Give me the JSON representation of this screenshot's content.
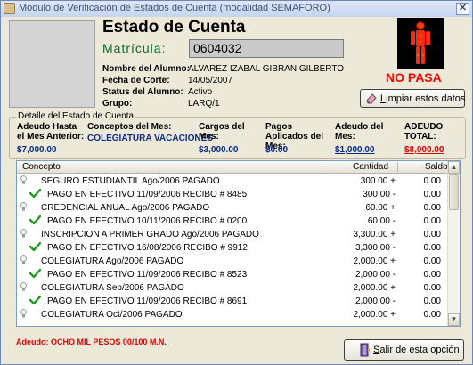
{
  "window": {
    "title": "Módulo de Verificación de Estados de Cuenta (modalidad SEMAFORO)",
    "close_label": "✕"
  },
  "header": {
    "title": "Estado de Cuenta",
    "matricula_label": "Matrícula:",
    "matricula_value": "0604032",
    "status_text": "NO PASA",
    "semaforo_icon": "red-pedestrian-light-icon",
    "status_color": "#ff0000"
  },
  "student": [
    {
      "label": "Nombre del Alumno:",
      "value": "ALVAREZ IZABAL  GIBRAN GILBERTO"
    },
    {
      "label": "Fecha de Corte:",
      "value": "14/05/2007"
    },
    {
      "label": "Status del Alumno:",
      "value": "Activo"
    },
    {
      "label": "Grupo:",
      "value": "LARQ/1"
    }
  ],
  "buttons": {
    "clear_label_u": "L",
    "clear_label_rest": "impiar estos datos",
    "exit_label_u": "S",
    "exit_label_rest": "alir de esta opción"
  },
  "detail": {
    "group_title": "Detalle del Estado de Cuenta",
    "col1_label": "Adeudo Hasta el Mes Anterior:",
    "col1_value": "$7,000.00",
    "col2_label": "Conceptos del Mes:",
    "col2_value": "COLEGIATURA VACACIONES",
    "col3_label": "Cargos del Mes:",
    "col3_value": "$3,000.00",
    "col4_label": "Pagos Aplicados del Mes:",
    "col4_value": "$0.00",
    "col5_label": "Adeudo del Mes:",
    "col5_value": "$1,000.00",
    "col6_label": "ADEUDO TOTAL:",
    "col6_value": "$8,000.00",
    "total_color": "#e00000",
    "value_color": "#0b2c8c"
  },
  "grid": {
    "headers": {
      "concepto": "Concepto",
      "cantidad": "Cantidad",
      "saldo": "Saldo"
    },
    "rows": [
      {
        "icon": "lightbulb-icon",
        "text": "SEGURO ESTUDIANTIL Ago/2006  PAGADO",
        "qty": "300.00 +",
        "bal": "0.00"
      },
      {
        "icon": "checkmark-icon",
        "text": "PAGO EN EFECTIVO 11/09/2006  RECIBO # 8485",
        "qty": "300.00 -",
        "bal": "0.00"
      },
      {
        "icon": "lightbulb-icon",
        "text": "CREDENCIAL ANUAL Ago/2006  PAGADO",
        "qty": "60.00 +",
        "bal": "0.00"
      },
      {
        "icon": "checkmark-icon",
        "text": "PAGO EN EFECTIVO 10/11/2006  RECIBO # 0200",
        "qty": "60.00 -",
        "bal": "0.00"
      },
      {
        "icon": "lightbulb-icon",
        "text": "INSCRIPCION A PRIMER GRADO Ago/2006  PAGADO",
        "qty": "3,300.00 +",
        "bal": "0.00"
      },
      {
        "icon": "checkmark-icon",
        "text": "PAGO EN EFECTIVO 16/08/2006  RECIBO # 9912",
        "qty": "3,300.00 -",
        "bal": "0.00"
      },
      {
        "icon": "lightbulb-icon",
        "text": "COLEGIATURA Ago/2006  PAGADO",
        "qty": "2,000.00 +",
        "bal": "0.00"
      },
      {
        "icon": "checkmark-icon",
        "text": "PAGO EN EFECTIVO 11/09/2006  RECIBO # 8523",
        "qty": "2,000.00 -",
        "bal": "0.00"
      },
      {
        "icon": "lightbulb-icon",
        "text": "COLEGIATURA Sep/2006  PAGADO",
        "qty": "2,000.00 +",
        "bal": "0.00"
      },
      {
        "icon": "checkmark-icon",
        "text": "PAGO EN EFECTIVO 11/09/2006  RECIBO # 8691",
        "qty": "2,000.00 -",
        "bal": "0.00"
      },
      {
        "icon": "lightbulb-icon",
        "text": "COLEGIATURA Oct/2006  PAGADO",
        "qty": "2,000.00 +",
        "bal": "0.00"
      }
    ]
  },
  "footer": {
    "adeudo_text": "Adeudo: OCHO MIL PESOS 00/100 M.N."
  }
}
